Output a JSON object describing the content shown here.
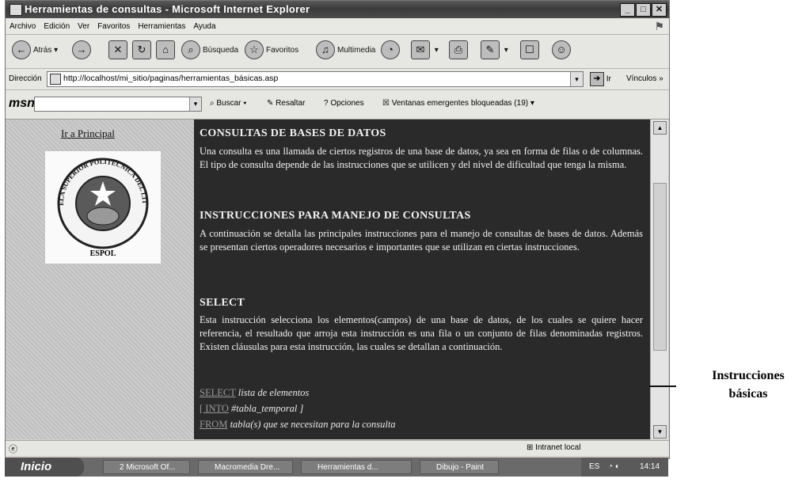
{
  "window": {
    "title": "Herramientas de consultas - Microsoft Internet Explorer",
    "min_label": "_",
    "max_label": "□",
    "close_label": "✕"
  },
  "menu": [
    "Archivo",
    "Edición",
    "Ver",
    "Favoritos",
    "Herramientas",
    "Ayuda"
  ],
  "toolbar": {
    "back": "Atrás",
    "search": "Búsqueda",
    "favorites": "Favoritos",
    "multimedia": "Multimedia"
  },
  "address": {
    "label": "Dirección",
    "url": "http://localhost/mi_sitio/paginas/herramientas_básicas.asp",
    "go": "Ir",
    "links": "Vínculos"
  },
  "msn": {
    "logo": "msn",
    "search": "Buscar",
    "highlight": "Resaltar",
    "options": "Opciones",
    "popups": "Ventanas emergentes bloqueadas (19)"
  },
  "sidebar": {
    "home_link": "Ir a Principal",
    "logo_top": "ESCUELA SUPERIOR POLITECNICA DEL LITORAL",
    "logo_caption": "ESPOL"
  },
  "main": {
    "h1": "CONSULTAS DE BASES DE DATOS",
    "p1": "Una consulta es una llamada de ciertos registros de una base de datos, ya sea en forma de filas o de columnas. El tipo de consulta depende de las instrucciones que se utilicen y del nivel de dificultad que tenga la misma.",
    "h2": "INSTRUCCIONES PARA MANEJO DE CONSULTAS",
    "p2": "A continuación se detalla las principales instrucciones para el manejo de consultas de bases de datos. Además se presentan ciertos operadores necesarios e importantes que se utilizan en ciertas instrucciones.",
    "h3": "SELECT",
    "p3": "Esta instrucción selecciona los elementos(campos) de una base de datos, de los cuales se quiere hacer referencia, el resultado que arroja esta instrucción es una fila o un conjunto de filas denominadas registros. Existen cláusulas para esta instrucción, las cuales se detallan a continuación.",
    "syntax": [
      {
        "keyword": "SELECT",
        "text": "lista de elementos"
      },
      {
        "keyword": "[ INTO",
        "text": "#tabla_temporal ]"
      },
      {
        "keyword": "FROM",
        "text": "tabla(s) que se necesitan para la consulta"
      }
    ]
  },
  "status": {
    "zone": "Intranet local"
  },
  "taskbar": {
    "start": "Inicio",
    "tasks": [
      "2 Microsoft Of...",
      "Macromedia Dre...",
      "Herramientas d...",
      "Dibujo - Paint"
    ],
    "lang": "ES",
    "clock": "14:14"
  },
  "annotation": {
    "line1": "Instrucciones",
    "line2": "básicas"
  }
}
